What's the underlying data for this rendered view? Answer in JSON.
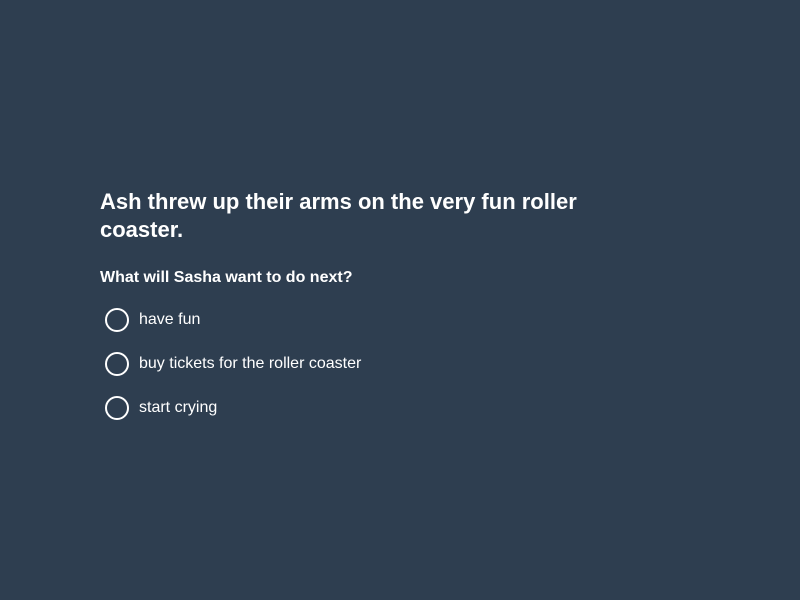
{
  "question": {
    "statement": "Ash threw up their arms on the very fun roller coaster.",
    "prompt": "What will Sasha want to do next?",
    "options": [
      {
        "label": "have fun",
        "selected": false
      },
      {
        "label": "buy tickets for the roller coaster",
        "selected": false
      },
      {
        "label": "start crying",
        "selected": false
      }
    ]
  },
  "colors": {
    "background": "#2e3e50",
    "text": "#ffffff"
  }
}
